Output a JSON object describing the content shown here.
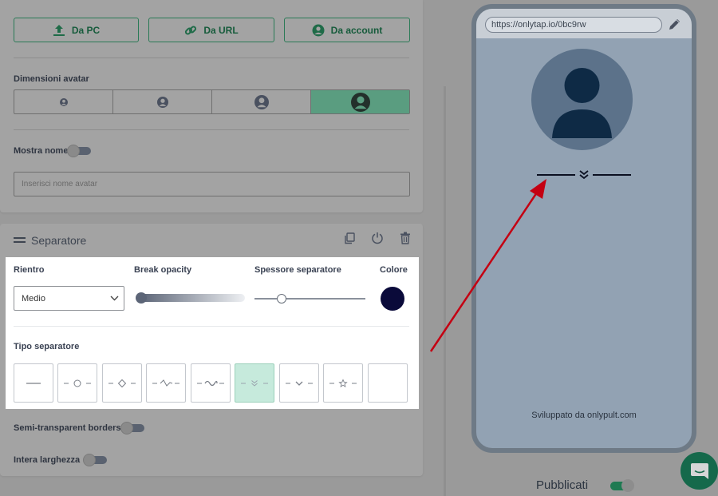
{
  "upload": {
    "pc_label": "Da PC",
    "url_label": "Da URL",
    "account_label": "Da account"
  },
  "avatar_settings": {
    "size_label": "Dimensioni avatar",
    "size_options": [
      "small-avatar-icon",
      "medium-avatar-icon",
      "large-avatar-icon",
      "xlarge-avatar-icon"
    ],
    "selected_size_index": 3,
    "show_name_label": "Mostra nome",
    "show_name_enabled": false,
    "name_placeholder": "Inserisci nome avatar"
  },
  "separator_block": {
    "title": "Separatore",
    "rientro_label": "Rientro",
    "rientro_value": "Medio",
    "break_opacity_label": "Break opacity",
    "break_opacity_value": 0,
    "thickness_label": "Spessore separatore",
    "thickness_value": 0.25,
    "color_label": "Colore",
    "color_value": "#0a0a3a",
    "type_label": "Tipo separatore",
    "types": [
      "line",
      "circle",
      "diamond",
      "zigzag",
      "wave",
      "chevrons",
      "chevron",
      "star",
      "empty"
    ],
    "selected_type_index": 5
  },
  "options": {
    "semi_transparent_label": "Semi-transparent borders",
    "semi_transparent_enabled": false,
    "full_width_label": "Intera larghezza",
    "full_width_enabled": false
  },
  "preview": {
    "url": "https://onlytap.io/0bc9rw",
    "footer": "Sviluppato da onlypult.com",
    "publish_label": "Pubblicati",
    "published": true
  },
  "colors": {
    "accent": "#2a7a56",
    "highlight_bg": "#ffffff",
    "selected_type_bg": "#c6eadc",
    "arrow": "#c40012"
  }
}
